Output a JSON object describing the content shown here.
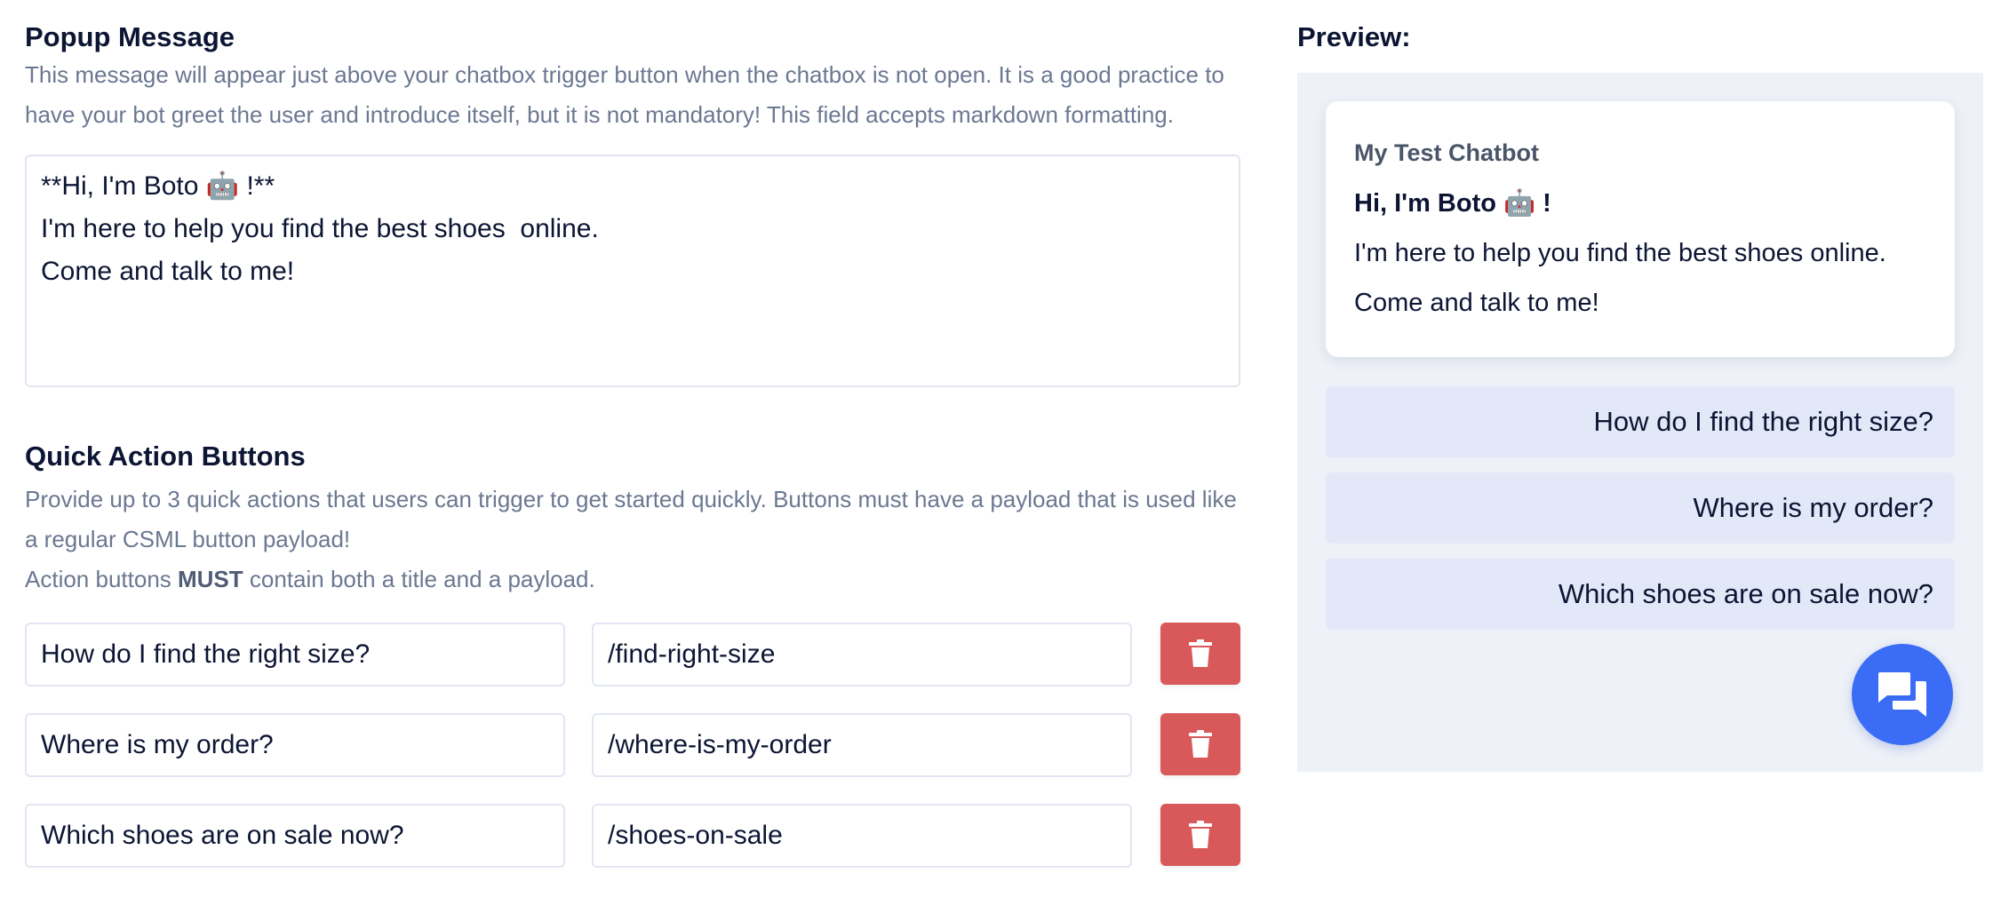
{
  "popup": {
    "title": "Popup Message",
    "help": "This message will appear just above your chatbox trigger button when the chatbox is not open. It is a good practice to have your bot greet the user and introduce itself, but it is not mandatory! This field accepts markdown formatting.",
    "value": "**Hi, I'm Boto 🤖 !**\nI'm here to help you find the best shoes  online.\nCome and talk to me!"
  },
  "quick_actions": {
    "title": "Quick Action Buttons",
    "help_line1": "Provide up to 3 quick actions that users can trigger to get started quickly. Buttons must have a payload that is used like a regular CSML button payload!",
    "help_line2_pre": "Action buttons ",
    "help_line2_bold": "MUST",
    "help_line2_post": " contain both a title and a payload.",
    "rows": [
      {
        "title": "How do I find the right size?",
        "payload": "/find-right-size"
      },
      {
        "title": "Where is my order?",
        "payload": "/where-is-my-order"
      },
      {
        "title": "Which shoes are on sale now?",
        "payload": "/shoes-on-sale"
      }
    ]
  },
  "preview": {
    "title": "Preview:",
    "bot_name": "My Test Chatbot",
    "greeting": "Hi, I'm Boto 🤖 !",
    "line1": "I'm here to help you find the best shoes online.",
    "line2": "Come and talk to me!",
    "buttons": [
      "How do I find the right size?",
      "Where is my order?",
      "Which shoes are on sale now?"
    ]
  },
  "icons": {
    "delete": "trash-icon",
    "chat": "chat-bubbles-icon"
  },
  "colors": {
    "delete": "#d9595b",
    "fab": "#3b6cf6",
    "quick_button": "#e3e8f9",
    "panel": "#eef1f7"
  }
}
